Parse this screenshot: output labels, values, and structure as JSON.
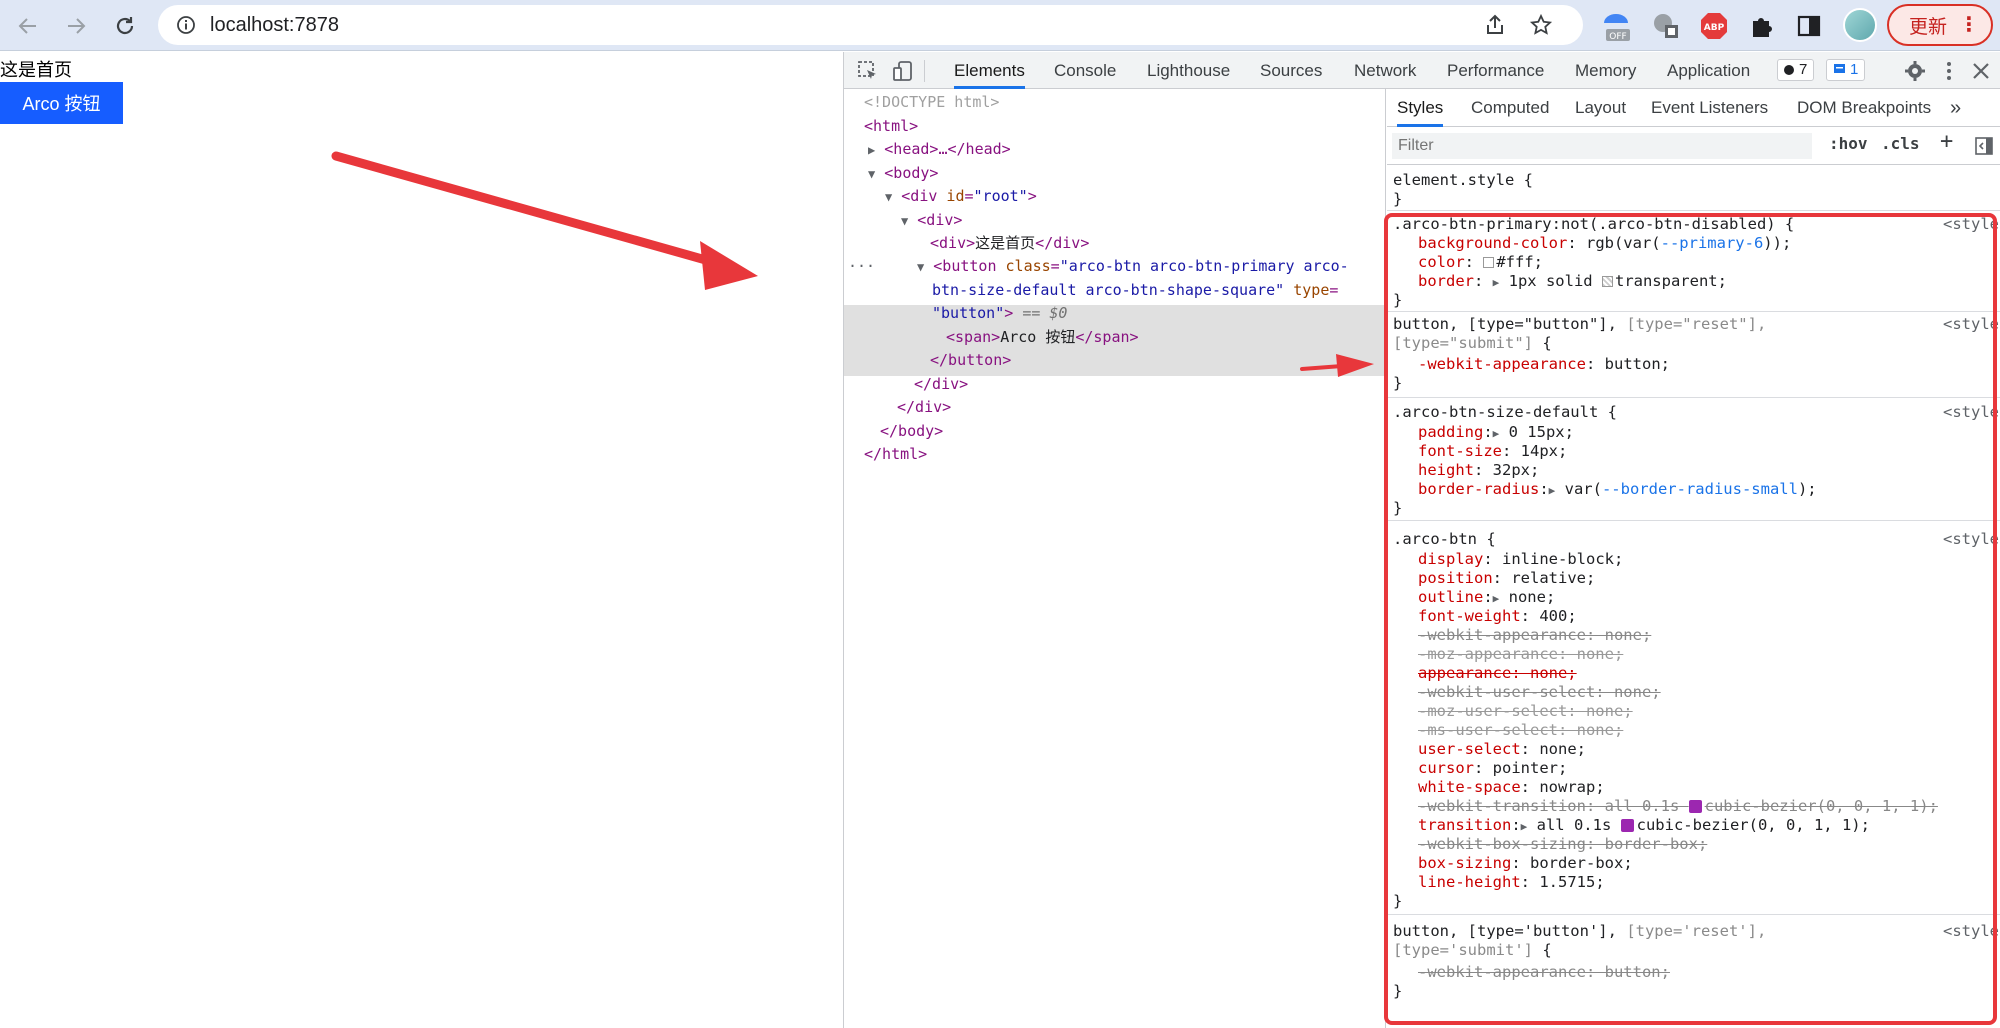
{
  "browser": {
    "url": "localhost:7878",
    "update_label": "更新",
    "update_menu_glyph": "⋮",
    "extensions": [
      "pinned-extension-icon",
      "translate-extension-icon",
      "adblock-plus-icon",
      "puzzle-extensions-icon",
      "side-panel-icon"
    ],
    "abp_label": "ABP",
    "off_label": "OFF"
  },
  "page": {
    "heading_text": "这是首页",
    "button_label": "Arco 按钮"
  },
  "devtools": {
    "tabs": [
      "Elements",
      "Console",
      "Lighthouse",
      "Sources",
      "Network",
      "Performance",
      "Memory",
      "Application"
    ],
    "active_tab": "Elements",
    "issues_count": "7",
    "messages_count": "1",
    "dom": {
      "doctype": "<!DOCTYPE html>",
      "html_open": "<html>",
      "head": "<head>…</head>",
      "body_open": "<body>",
      "div_root": "<div id=\"root\">",
      "div_open": "<div>",
      "div_text": "<div>这是首页</div>",
      "button_line1": "<button class=\"arco-btn arco-btn-primary arco-",
      "button_line2": "btn-size-default arco-btn-shape-square\" type=",
      "button_line3": "\"button\">",
      "selected_marker": "== $0",
      "span": "<span>Arco 按钮</span>",
      "button_close": "</button>",
      "div_close": "</div>",
      "div_close2": "</div>",
      "body_close": "</body>",
      "html_close": "</html>",
      "ellipsis": "···"
    },
    "styles": {
      "tabs": [
        "Styles",
        "Computed",
        "Layout",
        "Event Listeners",
        "DOM Breakpoints"
      ],
      "active_tab": "Styles",
      "more_tabs": "»",
      "filter_placeholder": "Filter",
      "hov": ":hov",
      "cls": ".cls",
      "add": "+",
      "element_style": "element.style {",
      "close_brace": "}",
      "source": "<style",
      "rules": {
        "primary_selector": ".arco-btn-primary:not(.arco-btn-disabled) {",
        "primary_bg_prop": "background-color",
        "primary_bg_val_a": "rgb(var(",
        "primary_bg_var": "--primary-6",
        "primary_bg_val_b": "));",
        "primary_color_prop": "color",
        "primary_color_val": "#fff;",
        "primary_border_prop": "border",
        "primary_border_val_a": "1px solid",
        "primary_border_val_b": "transparent;",
        "btn_type_selector_a": "button, [type=\"button\"],",
        "btn_type_selector_b": "[type=\"reset\"],",
        "btn_type_selector_c": "[type=\"submit\"]",
        "btn_type_selector_d": " {",
        "webkit_appearance_prop": "-webkit-appearance",
        "webkit_appearance_val": "button;",
        "size_selector": ".arco-btn-size-default {",
        "padding_prop": "padding",
        "padding_val": "0 15px;",
        "font_size_prop": "font-size",
        "font_size_val": "14px;",
        "height_prop": "height",
        "height_val": "32px;",
        "radius_prop": "border-radius",
        "radius_val_a": "var(",
        "radius_var": "--border-radius-small",
        "radius_val_b": ");",
        "btn_selector": ".arco-btn {",
        "display_prop": "display",
        "display_val": "inline-block;",
        "position_prop": "position",
        "position_val": "relative;",
        "outline_prop": "outline",
        "outline_val": "none;",
        "fw_prop": "font-weight",
        "fw_val": "400;",
        "s_wk_app": "-webkit-appearance: none;",
        "s_moz_app": "-moz-appearance: none;",
        "s_app": "appearance: none;",
        "s_wk_us": "-webkit-user-select: none;",
        "s_moz_us": "-moz-user-select: none;",
        "s_ms_us": "-ms-user-select: none;",
        "us_prop": "user-select",
        "us_val": "none;",
        "cursor_prop": "cursor",
        "cursor_val": "pointer;",
        "ws_prop": "white-space",
        "ws_val": "nowrap;",
        "s_wk_trans_a": "-webkit-transition: all 0.1s ",
        "s_wk_trans_b": "cubic-bezier(0, 0, 1, 1);",
        "trans_prop": "transition",
        "trans_val_a": "all 0.1s ",
        "trans_val_b": "cubic-bezier(0, 0, 1, 1);",
        "s_wk_bs": "-webkit-box-sizing: border-box;",
        "bs_prop": "box-sizing",
        "bs_val": "border-box;",
        "lh_prop": "line-height",
        "lh_val": "1.5715;",
        "btn_type2_selector_a": "button, [type='button'],",
        "btn_type2_selector_b": "[type='reset'],",
        "btn_type2_selector_c": "[type='submit']",
        "btn_type2_selector_d": " {",
        "s_wk_app2": "-webkit-appearance: button;"
      }
    }
  },
  "colors": {
    "accent_blue": "#1a73e8",
    "arco_primary": "#165dff",
    "annotation_red": "#e8373b"
  }
}
